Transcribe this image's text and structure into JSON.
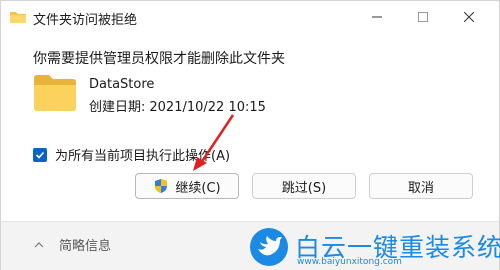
{
  "window": {
    "title": "文件夹访问被拒绝",
    "controls": {
      "minimize_icon": "minimize-icon",
      "maximize_icon": "maximize-icon",
      "close_icon": "close-icon"
    }
  },
  "content": {
    "message": "你需要提供管理员权限才能删除此文件夹",
    "item": {
      "icon": "folder-icon",
      "name": "DataStore",
      "date_label": "创建日期:",
      "date_value": "2021/10/22 10:15"
    },
    "apply_all": {
      "checked": true,
      "label": "为所有当前项目执行此操作(A)"
    }
  },
  "buttons": {
    "continue_label": "继续(C)",
    "skip_label": "跳过(S)",
    "cancel_label": "取消"
  },
  "footer": {
    "details_label": "简略信息"
  },
  "watermark": {
    "brand": "白云一键重装系统",
    "url": "www.baiyunxitong.com"
  },
  "colors": {
    "accent": "#0a64c8",
    "annotation": "#e02020",
    "watermark": "#1a8ae5"
  }
}
